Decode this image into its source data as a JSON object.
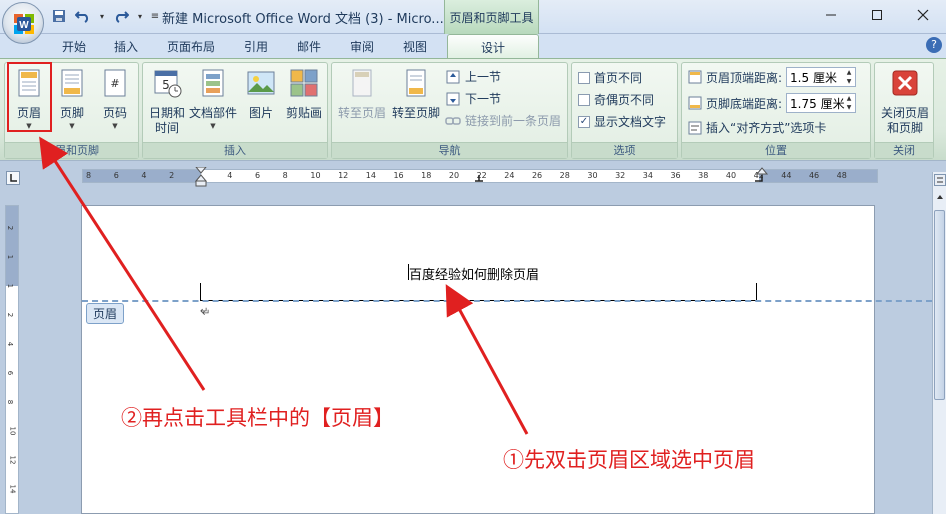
{
  "window": {
    "title": "新建 Microsoft Office Word 文档 (3) - Micro...",
    "context_tab": "页眉和页脚工具",
    "controls": [
      "minimize",
      "maximize",
      "close"
    ]
  },
  "tabs": [
    "开始",
    "插入",
    "页面布局",
    "引用",
    "邮件",
    "审阅",
    "视图"
  ],
  "active_tab": "设计",
  "ribbon": {
    "group_header_footer": {
      "label": "页眉和页脚",
      "buttons": {
        "header": "页眉",
        "footer": "页脚",
        "page_number": "页码"
      }
    },
    "group_insert": {
      "label": "插入",
      "buttons": {
        "datetime_1": "日期和",
        "datetime_2": "时间",
        "quickparts": "文档部件",
        "picture": "图片",
        "clipart": "剪贴画"
      }
    },
    "group_nav": {
      "label": "导航",
      "buttons": {
        "goto_header": "转至页眉",
        "goto_footer": "转至页脚",
        "prev": "上一节",
        "next": "下一节",
        "link_prev": "链接到前一条页眉"
      }
    },
    "group_options": {
      "label": "选项",
      "items": [
        {
          "label": "首页不同",
          "checked": false
        },
        {
          "label": "奇偶页不同",
          "checked": false
        },
        {
          "label": "显示文档文字",
          "checked": true
        }
      ]
    },
    "group_position": {
      "label": "位置",
      "header_distance_label": "页眉顶端距离:",
      "header_distance_value": "1.5 厘米",
      "footer_distance_label": "页脚底端距离:",
      "footer_distance_value": "1.75 厘米",
      "insert_align_tab": "插入“对齐方式”选项卡"
    },
    "group_close": {
      "label": "关闭",
      "button_1": "关闭页眉",
      "button_2": "和页脚"
    }
  },
  "ruler": {
    "h_ticks": [
      "8",
      "6",
      "4",
      "2",
      "2",
      "4",
      "6",
      "8",
      "10",
      "12",
      "14",
      "16",
      "18",
      "20",
      "22",
      "24",
      "26",
      "28",
      "30",
      "32",
      "34",
      "36",
      "38",
      "40",
      "42",
      "44",
      "46",
      "48"
    ],
    "v_ticks": [
      "2",
      "1",
      "1",
      "2",
      "4",
      "6",
      "8",
      "10",
      "12",
      "14"
    ]
  },
  "document": {
    "header_text": "百度经验如何删除页眉",
    "header_badge": "页眉",
    "para_mark": "↵"
  },
  "annotations": {
    "step1": "①先双击页眉区域选中页眉",
    "step2": "②再点击工具栏中的【页眉】"
  },
  "colors": {
    "annotation_red": "#e02020",
    "ribbon_green": "#dbe9dd",
    "header_dash": "#7da1c9"
  }
}
